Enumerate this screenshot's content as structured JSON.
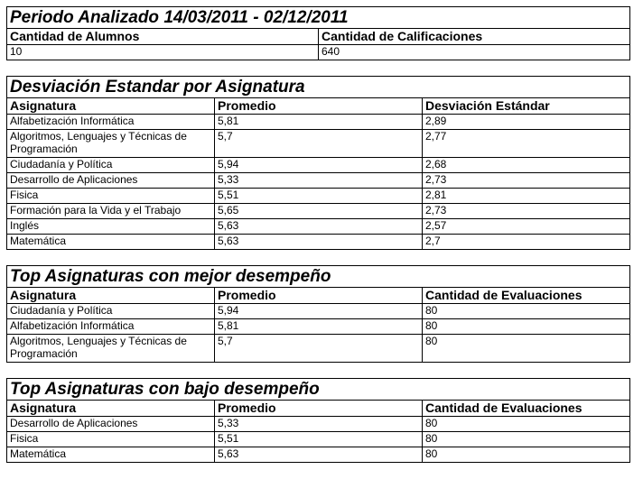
{
  "period": {
    "title": "Periodo Analizado 14/03/2011 - 02/12/2011",
    "headers": [
      "Cantidad de Alumnos",
      "Cantidad de Calificaciones"
    ],
    "values": [
      "10",
      "640"
    ]
  },
  "std_dev": {
    "title": "Desviación Estandar por Asignatura",
    "headers": [
      "Asignatura",
      "Promedio",
      "Desviación Estándar"
    ],
    "rows": [
      [
        "Alfabetización Informática",
        "5,81",
        "2,89"
      ],
      [
        "Algoritmos, Lenguajes y Técnicas de Programación",
        "5,7",
        "2,77"
      ],
      [
        "Ciudadanía y Política",
        "5,94",
        "2,68"
      ],
      [
        "Desarrollo de Aplicaciones",
        "5,33",
        "2,73"
      ],
      [
        "Fisica",
        "5,51",
        "2,81"
      ],
      [
        "Formación para la Vida y el Trabajo",
        "5,65",
        "2,73"
      ],
      [
        "Inglés",
        "5,63",
        "2,57"
      ],
      [
        "Matemática",
        "5,63",
        "2,7"
      ]
    ]
  },
  "top_best": {
    "title": "Top Asignaturas con mejor desempeño",
    "headers": [
      "Asignatura",
      "Promedio",
      "Cantidad de Evaluaciones"
    ],
    "rows": [
      [
        "Ciudadanía y Política",
        "5,94",
        "80"
      ],
      [
        "Alfabetización Informática",
        "5,81",
        "80"
      ],
      [
        "Algoritmos, Lenguajes y Técnicas de Programación",
        "5,7",
        "80"
      ]
    ]
  },
  "top_worst": {
    "title": "Top Asignaturas con bajo desempeño",
    "headers": [
      "Asignatura",
      "Promedio",
      "Cantidad de Evaluaciones"
    ],
    "rows": [
      [
        "Desarrollo de Aplicaciones",
        "5,33",
        "80"
      ],
      [
        "Fisica",
        "5,51",
        "80"
      ],
      [
        "Matemática",
        "5,63",
        "80"
      ]
    ]
  }
}
